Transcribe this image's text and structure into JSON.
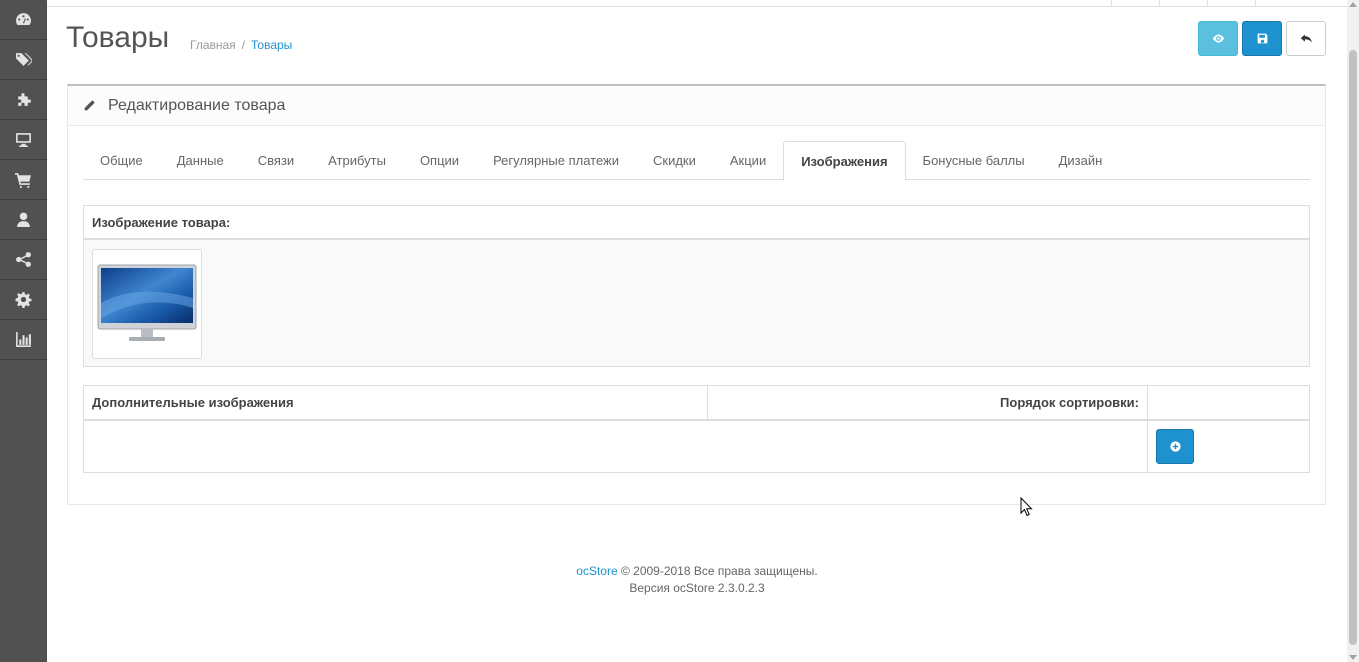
{
  "page": {
    "title": "Товары"
  },
  "breadcrumb": {
    "home": "Главная",
    "separator": "/",
    "current": "Товары"
  },
  "header_buttons": [
    {
      "icon": "eye-icon",
      "color": "#5bc0de"
    },
    {
      "icon": "save-icon",
      "color": "#1e91cf"
    },
    {
      "icon": "reply-icon",
      "color": "#ffffff"
    }
  ],
  "sidebar": {
    "items": [
      {
        "icon": "dashboard-icon"
      },
      {
        "icon": "tags-icon"
      },
      {
        "icon": "puzzle-icon"
      },
      {
        "icon": "desktop-icon"
      },
      {
        "icon": "cart-icon"
      },
      {
        "icon": "user-icon"
      },
      {
        "icon": "share-icon"
      },
      {
        "icon": "cog-icon"
      },
      {
        "icon": "bar-chart-icon"
      }
    ]
  },
  "panel": {
    "title": "Редактирование товара",
    "title_icon": "pencil-icon"
  },
  "tabs": [
    {
      "label": "Общие",
      "active": false
    },
    {
      "label": "Данные",
      "active": false
    },
    {
      "label": "Связи",
      "active": false
    },
    {
      "label": "Атрибуты",
      "active": false
    },
    {
      "label": "Опции",
      "active": false
    },
    {
      "label": "Регулярные платежи",
      "active": false
    },
    {
      "label": "Скидки",
      "active": false
    },
    {
      "label": "Акции",
      "active": false
    },
    {
      "label": "Изображения",
      "active": true
    },
    {
      "label": "Бонусные баллы",
      "active": false
    },
    {
      "label": "Дизайн",
      "active": false
    }
  ],
  "image_section": {
    "header": "Изображение товара:",
    "thumbnail_icon": "monitor-image"
  },
  "additional_images": {
    "col_images": "Дополнительные изображения",
    "col_sort": "Порядок сортировки:",
    "add_icon": "plus-circle-icon"
  },
  "footer": {
    "brand": "ocStore",
    "copyright": "© 2009-2018 Все права защищены.",
    "version": "Версия ocStore 2.3.0.2.3"
  },
  "colors": {
    "sidebar_bg": "#515151",
    "primary": "#1e91cf",
    "info": "#5bc0de"
  }
}
